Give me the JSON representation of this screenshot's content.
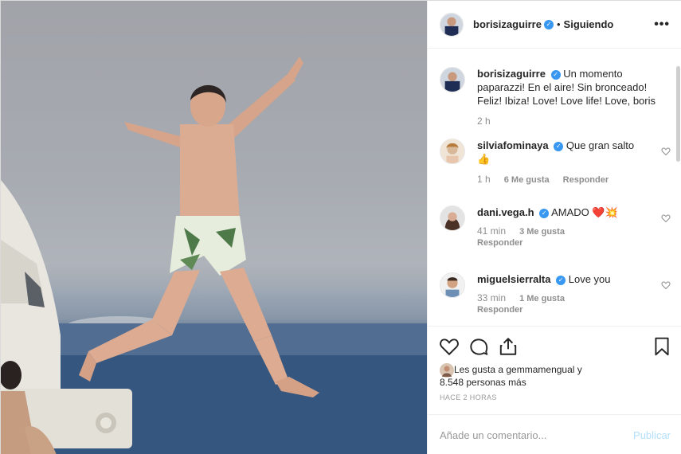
{
  "header": {
    "username": "borisizaguirre",
    "verified_mark": "✓",
    "separator": "•",
    "following_label": "Siguiendo",
    "more_label": "•••"
  },
  "caption": {
    "username": "borisizaguirre",
    "text": "Un momento paparazzi! En el aire! Sin bronceado! Feliz! Ibiza! Love! Love life! Love, boris",
    "time": "2 h"
  },
  "comments": [
    {
      "username": "silviafominaya",
      "text": "Que gran salto",
      "emoji": "👍",
      "time": "1 h",
      "likes": "6 Me gusta",
      "reply": "Responder"
    },
    {
      "username": "dani.vega.h",
      "text": "AMADO",
      "emoji": "❤️💥",
      "time": "41 min",
      "likes": "3 Me gusta",
      "reply": "Responder"
    },
    {
      "username": "miguelsierralta",
      "text": "Love you",
      "emoji": "",
      "time": "33 min",
      "likes": "1 Me gusta",
      "reply": "Responder"
    }
  ],
  "actions": {
    "icons": [
      "heart-icon",
      "comment-icon",
      "share-icon",
      "bookmark-icon"
    ]
  },
  "likes": {
    "line1": "Les gusta a gemmamengual y",
    "line2": "8.548 personas más"
  },
  "posted_ago": "HACE 2 HORAS",
  "comment_box": {
    "placeholder": "Añade un comentario...",
    "post_label": "Publicar"
  },
  "colors": {
    "verified": "#3897f0",
    "publish_disabled": "#b2dffc",
    "muted": "#8e8e8e"
  }
}
